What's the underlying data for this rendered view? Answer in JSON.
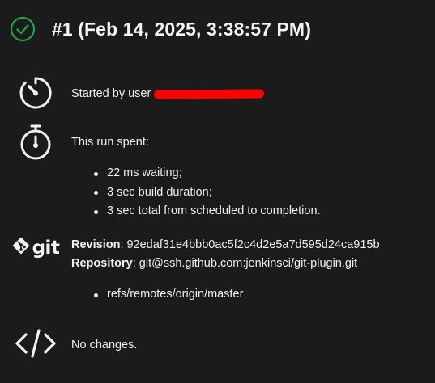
{
  "build": {
    "title": "#1 (Feb 14, 2025, 3:38:57 PM)",
    "status": "success",
    "status_icon": "check-circle-icon"
  },
  "started_by": {
    "text": "Started by user",
    "icon": "timer-icon"
  },
  "timing": {
    "heading": "This run spent:",
    "icon": "stopwatch-icon",
    "items": [
      "22 ms waiting;",
      "3 sec build duration;",
      "3 sec total from scheduled to completion."
    ]
  },
  "git": {
    "logo_text": "git",
    "revision_label": "Revision",
    "revision_value": ": 92edaf31e4bbb0ac5f2c4d2e5a7d595d24ca915b",
    "repository_label": "Repository",
    "repository_value": ": git@ssh.github.com:jenkinsci/git-plugin.git",
    "branches": [
      "refs/remotes/origin/master"
    ]
  },
  "changes": {
    "text": "No changes.",
    "icon": "code-icon"
  },
  "colors": {
    "background": "#1b1b1b",
    "success": "#1ea446",
    "redaction": "#ff0000"
  }
}
